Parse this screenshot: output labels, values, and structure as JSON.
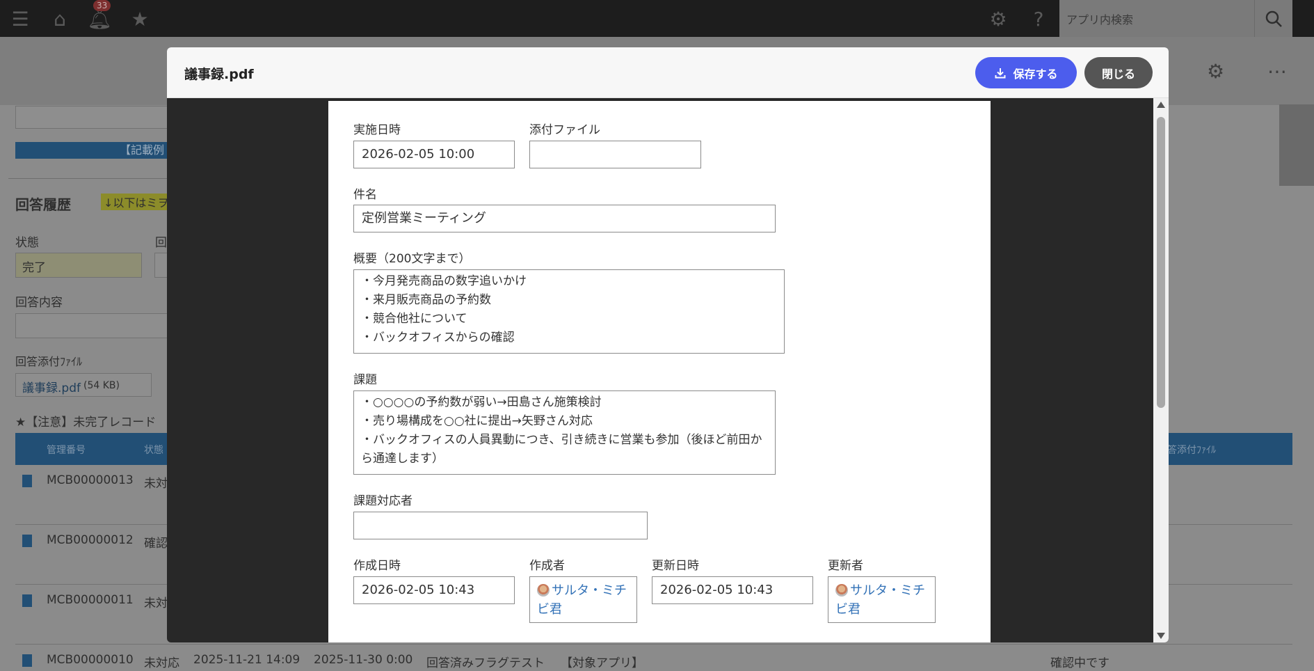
{
  "topbar": {
    "badge_count": "33",
    "search_placeholder": "アプリ内検索"
  },
  "background": {
    "section_title": "回答履歴",
    "notice_tag": "↓以下はミヲ",
    "banner_text": "【記載例",
    "status_label": "状態",
    "col2_label": "回",
    "status_value": "完了",
    "answer_label": "回答内容",
    "attach_label": "回答添付ﾌｧｲﾙ",
    "attach_link": "議事録.pdf",
    "attach_size": "(54 KB)",
    "warning": "★【注意】未完了レコード",
    "table_headers": [
      "管理番号",
      "状態",
      "答添付ﾌｧｲﾙ"
    ],
    "rows": [
      {
        "id": "MCB00000013",
        "status": "未対"
      },
      {
        "id": "MCB00000012",
        "status": "確認"
      },
      {
        "id": "MCB00000011",
        "status": "未対"
      },
      {
        "id": "MCB00000010",
        "status": "未対応",
        "created": "2025-11-21 14:09",
        "deadline": "2025-11-30 0:00",
        "title": "回答済みフラグテスト",
        "target": "【対象アプリ】",
        "answer": "確認中です"
      }
    ]
  },
  "modal": {
    "title": "議事録.pdf",
    "save_label": "保存する",
    "close_label": "閉じる"
  },
  "document": {
    "date_label": "実施日時",
    "date_value": "2026-02-05 10:00",
    "attachment_label": "添付ファイル",
    "attachment_value": "",
    "subject_label": "件名",
    "subject_value": "定例営業ミーティング",
    "summary_label": "概要（200文字まで）",
    "summary_value": "・今月発売商品の数字追いかけ\n・来月販売商品の予約数\n・競合他社について\n・バックオフィスからの確認",
    "issues_label": "課題",
    "issues_value": "・○○○○の予約数が弱い→田島さん施策検討\n・売り場構成を○○社に提出→矢野さん対応\n・バックオフィスの人員異動につき、引き続きに営業も参加（後ほど前田から通達します）",
    "assignee_label": "課題対応者",
    "assignee_value": "",
    "created_label": "作成日時",
    "created_value": "2026-02-05 10:43",
    "creator_label": "作成者",
    "creator_value": "サルタ・ミチビ君",
    "updated_label": "更新日時",
    "updated_value": "2026-02-05 10:43",
    "updater_label": "更新者",
    "updater_value": "サルタ・ミチビ君"
  }
}
